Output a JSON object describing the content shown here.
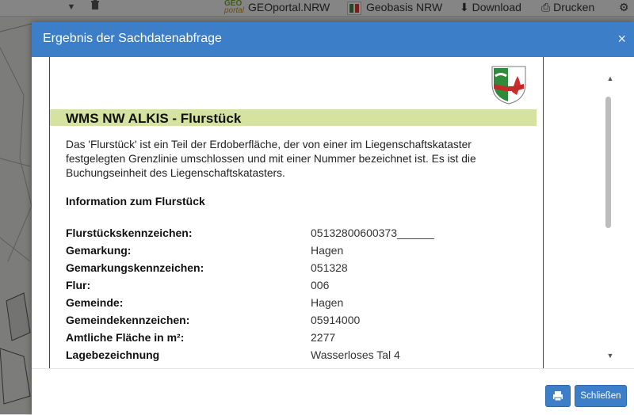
{
  "toolbar": {
    "items": [
      {
        "label": "GEOportal.NRW"
      },
      {
        "label": "Geobasis NRW"
      },
      {
        "label": "Download"
      },
      {
        "label": "Drucken"
      }
    ],
    "geo_logo_top": "GEO",
    "geo_logo_bottom": "portal",
    "icons": [
      "chevron-down-icon",
      "trash-icon",
      "download-icon",
      "printer-icon",
      "gear-icon"
    ]
  },
  "modal": {
    "title": "Ergebnis der Sachdatenabfrage",
    "close_glyph": "×",
    "footer": {
      "close_label": "Schließen"
    }
  },
  "document": {
    "heading": "WMS NW ALKIS - Flurstück",
    "description": "Das 'Flurstück' ist ein Teil der Erdoberfläche, der von einer im Liegenschaftskataster festgelegten Grenzlinie umschlossen und mit einer Nummer bezeichnet ist. Es ist die Buchungseinheit des Liegenschaftskatasters.",
    "section_title": "Information zum Flurstück",
    "rows": [
      {
        "label": "Flurstückskennzeichen:",
        "value": "05132800600373______"
      },
      {
        "label": "Gemarkung:",
        "value": "Hagen"
      },
      {
        "label": "Gemarkungskennzeichen:",
        "value": "051328"
      },
      {
        "label": "Flur:",
        "value": "006"
      },
      {
        "label": "Gemeinde:",
        "value": "Hagen"
      },
      {
        "label": "Gemeindekennzeichen:",
        "value": "05914000"
      },
      {
        "label": "Amtliche Fläche in m²:",
        "value": "2277"
      },
      {
        "label": "Lagebezeichnung",
        "value": "Wasserloses Tal 4"
      }
    ]
  },
  "colors": {
    "header": "#3c7ec7",
    "title_bar": "#d6e3a0"
  }
}
